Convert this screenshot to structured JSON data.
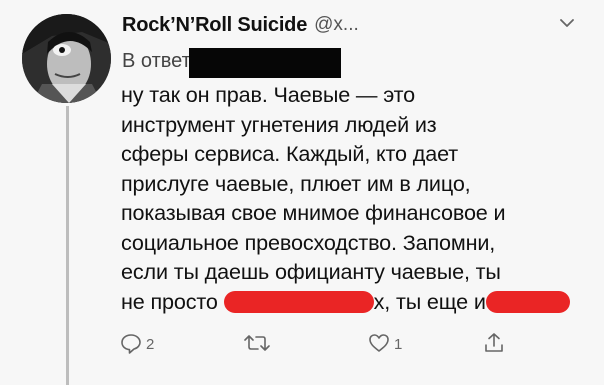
{
  "tweet": {
    "display_name": "Rock’N’Roll Suicide",
    "handle": "@x...",
    "reply_prefix": "В ответ",
    "text_lines": {
      "l1": "ну так он прав. Чаевые — это",
      "l2": "инструмент угнетения людей из",
      "l3": "сферы сервиса. Каждый, кто дает",
      "l4": "прислуге чаевые, плюет им в лицо,",
      "l5": "показывая свое мнимое финансовое и",
      "l6": "социальное превосходство. Запомни,",
      "l7": "если ты даешь официанту чаевые, ты",
      "l8_a": "не просто",
      "l8_b": "х, ты еще и"
    }
  },
  "actions": {
    "reply_count": "2",
    "like_count": "1"
  },
  "icons": {
    "chevron": "chevron-down-icon",
    "reply": "reply-icon",
    "retweet": "retweet-icon",
    "like": "heart-icon",
    "share": "share-icon"
  },
  "colors": {
    "redaction_red": "#ea2525",
    "redaction_black": "#060606",
    "background": "#f7f7f7"
  }
}
